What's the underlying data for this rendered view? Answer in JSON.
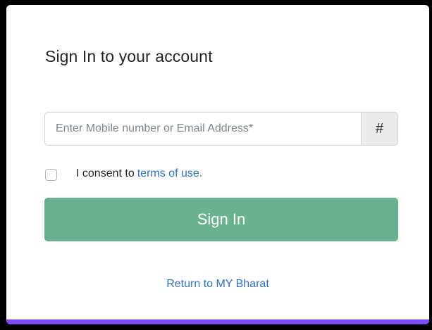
{
  "login": {
    "title": "Sign In to your account",
    "input": {
      "value": "",
      "placeholder": "Enter Mobile number or Email Address*",
      "addon": "#"
    },
    "consent": {
      "checked": false,
      "text": "I consent to",
      "link_text": "terms of use."
    },
    "submit_label": "Sign In",
    "return_link": "Return to MY Bharat"
  },
  "colors": {
    "button_bg": "#68b28f",
    "link": "#2f6fcf",
    "accent_bar": "#7c4dff",
    "background": "#000000"
  }
}
